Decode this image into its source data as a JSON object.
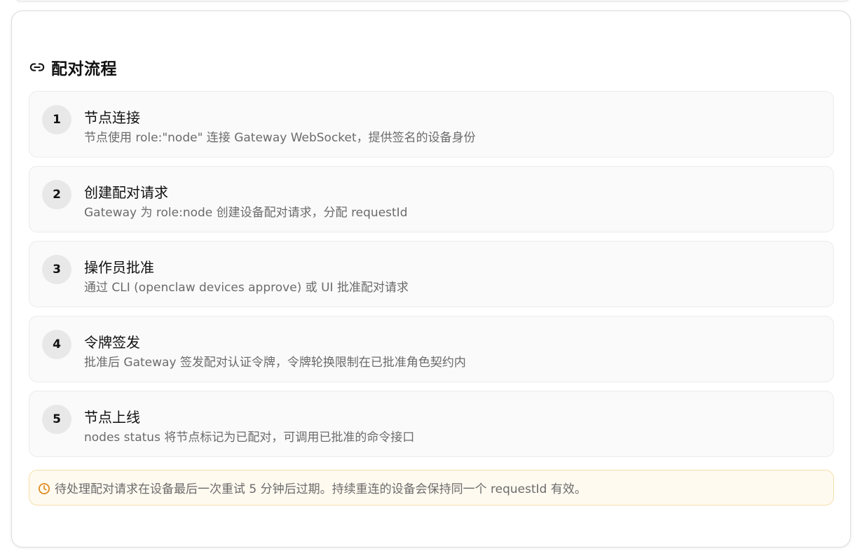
{
  "section": {
    "title": "配对流程",
    "icon": "link-icon"
  },
  "steps": [
    {
      "number": "1",
      "title": "节点连接",
      "description": "节点使用 role:\"node\" 连接 Gateway WebSocket，提供签名的设备身份"
    },
    {
      "number": "2",
      "title": "创建配对请求",
      "description": "Gateway 为 role:node 创建设备配对请求，分配 requestId"
    },
    {
      "number": "3",
      "title": "操作员批准",
      "description": "通过 CLI (openclaw devices approve) 或 UI 批准配对请求"
    },
    {
      "number": "4",
      "title": "令牌签发",
      "description": "批准后 Gateway 签发配对认证令牌，令牌轮换限制在已批准角色契约内"
    },
    {
      "number": "5",
      "title": "节点上线",
      "description": "nodes status 将节点标记为已配对，可调用已批准的命令接口"
    }
  ],
  "notice": {
    "icon": "clock-icon",
    "text": "待处理配对请求在设备最后一次重试 5 分钟后过期。持续重连的设备会保持同一个 requestId 有效。"
  },
  "colors": {
    "accent_warning": "#e08a1e",
    "notice_bg": "#fffaf0",
    "notice_border": "#f6dfaa",
    "step_bg": "#fafafa",
    "number_badge_bg": "#e8e8e8"
  }
}
